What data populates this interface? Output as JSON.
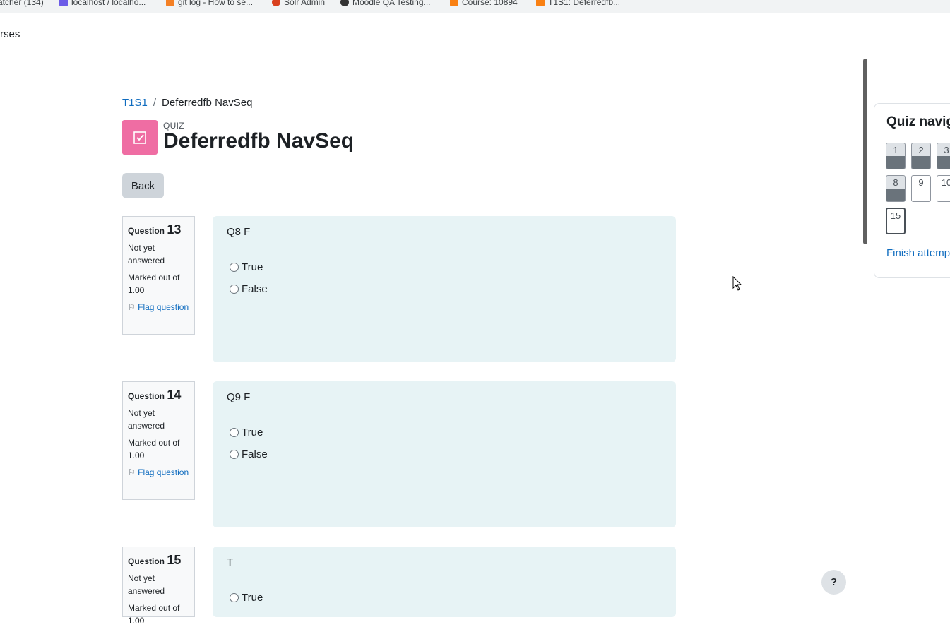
{
  "bookmarks": [
    {
      "label": "atcher (134)",
      "color": "#888888"
    },
    {
      "label": "localhost / localho...",
      "color": "#6c5ce7"
    },
    {
      "label": "git log - How to se...",
      "color": "#f48024"
    },
    {
      "label": "Solr Admin",
      "color": "#d9411e"
    },
    {
      "label": "Moodle QA Testing...",
      "color": "#333333"
    },
    {
      "label": "Course: 10894",
      "color": "#f98012"
    },
    {
      "label": "T1S1: Deferredfb...",
      "color": "#f98012"
    }
  ],
  "topnav": {
    "item": "rses"
  },
  "breadcrumb": {
    "course": "T1S1",
    "separator": "/",
    "current": "Deferredfb NavSeq"
  },
  "header": {
    "module_type": "QUIZ",
    "title": "Deferredfb NavSeq"
  },
  "back_label": "Back",
  "questions": [
    {
      "label": "Question",
      "number": "13",
      "state": "Not yet answered",
      "grade": "Marked out of 1.00",
      "flag": "Flag question",
      "text": "Q8 F",
      "answers": [
        "True",
        "False"
      ]
    },
    {
      "label": "Question",
      "number": "14",
      "state": "Not yet answered",
      "grade": "Marked out of 1.00",
      "flag": "Flag question",
      "text": "Q9 F",
      "answers": [
        "True",
        "False"
      ]
    },
    {
      "label": "Question",
      "number": "15",
      "state": "Not yet answered",
      "grade": "Marked out of 1.00",
      "flag": "Flag question",
      "text": "T",
      "answers": [
        "True"
      ]
    }
  ],
  "quiz_nav": {
    "title": "Quiz navig",
    "buttons": [
      {
        "label": "1",
        "state": "answered"
      },
      {
        "label": "2",
        "state": "answered"
      },
      {
        "label": "3",
        "state": "answered"
      },
      {
        "label": "8",
        "state": "answered"
      },
      {
        "label": "9",
        "state": "notyetanswered"
      },
      {
        "label": "10",
        "state": "notyetanswered"
      },
      {
        "label": "15",
        "state": "current"
      }
    ],
    "finish": "Finish attemp"
  },
  "help_label": "?",
  "colors": {
    "accent": "#0f6cbf",
    "quiz_icon": "#ef6da3",
    "question_bg": "#e7f3f5"
  }
}
